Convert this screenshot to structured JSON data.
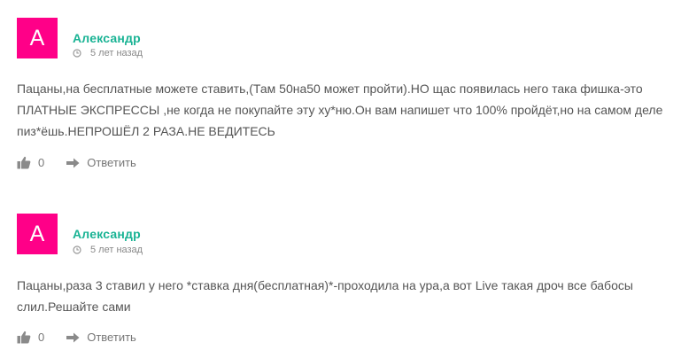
{
  "comments": [
    {
      "avatar_letter": "A",
      "author": "Александр",
      "time": "5 лет назад",
      "text": "Пацаны,на бесплатные можете ставить,(Там 50на50 может пройти).НО щас появилась него така фишка-это ПЛАТНЫЕ ЭКСПРЕССЫ ,не когда не покупайте эту ху*ню.Он вам напишет что 100% пройдёт,но на самом деле пиз*ёшь.НЕПРОШЁЛ 2 РАЗА.НЕ ВЕДИТЕСЬ",
      "likes": "0",
      "reply_label": "Ответить"
    },
    {
      "avatar_letter": "A",
      "author": "Александр",
      "time": "5 лет назад",
      "text": "Пацаны,раза 3 ставил у него *ставка дня(бесплатная)*-проходила на ура,а вот Live такая дроч все бабосы слил.Решайте сами",
      "likes": "0",
      "reply_label": "Ответить"
    }
  ],
  "colors": {
    "avatar_bg": "#ff0088",
    "author": "#19b394",
    "text": "#555555",
    "meta": "#888888"
  },
  "icons": {
    "time": "clock-icon",
    "like": "thumbs-up-icon",
    "reply": "reply-arrow-icon"
  }
}
